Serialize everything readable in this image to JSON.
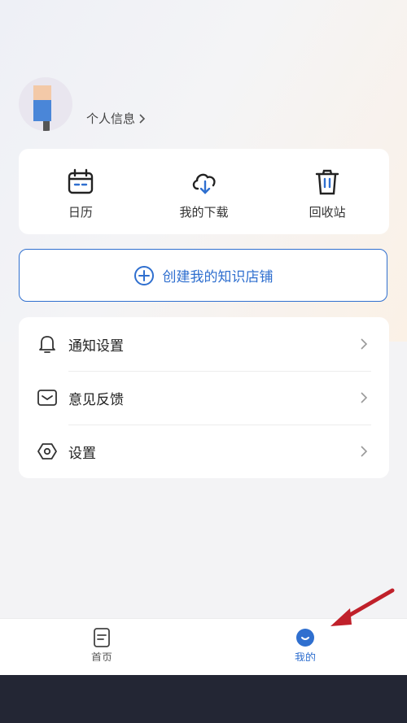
{
  "profile": {
    "link_label": "个人信息"
  },
  "quick_actions": [
    {
      "label": "日历",
      "icon": "calendar-icon"
    },
    {
      "label": "我的下载",
      "icon": "cloud-download-icon"
    },
    {
      "label": "回收站",
      "icon": "trash-icon"
    }
  ],
  "create_store": {
    "label": "创建我的知识店铺",
    "icon": "plus-circle-icon"
  },
  "menu": [
    {
      "label": "通知设置",
      "icon": "bell-icon"
    },
    {
      "label": "意见反馈",
      "icon": "envelope-icon"
    },
    {
      "label": "设置",
      "icon": "hexagon-settings-icon"
    }
  ],
  "tabbar": {
    "tabs": [
      {
        "label": "首页",
        "icon": "document-icon",
        "active": false
      },
      {
        "label": "我的",
        "icon": "smile-icon",
        "active": true
      }
    ]
  },
  "colors": {
    "accent": "#2f6fcf",
    "annotation_arrow": "#c0202a",
    "system_bar": "#232634"
  }
}
